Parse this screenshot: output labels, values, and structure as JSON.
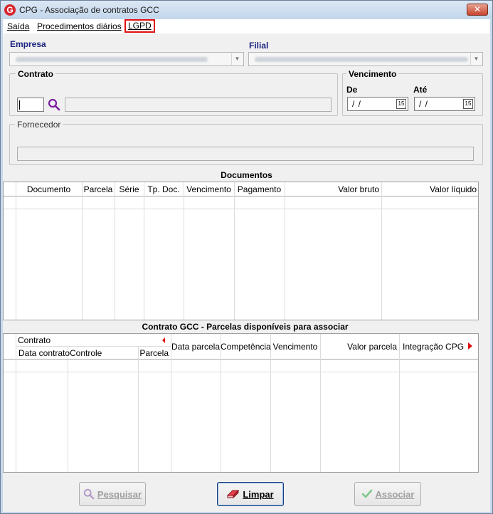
{
  "window": {
    "title": "CPG - Associação de contratos GCC",
    "close_label": "✕"
  },
  "menu": {
    "items": [
      {
        "label": "Saída"
      },
      {
        "label": "Procedimentos diários"
      },
      {
        "label": "LGPD"
      }
    ]
  },
  "filters": {
    "empresa_label": "Empresa",
    "filial_label": "Filial",
    "contrato_label": "Contrato",
    "vencimento_label": "Vencimento",
    "de_label": "De",
    "ate_label": "Até",
    "de_value": "/ /",
    "ate_value": "/ /",
    "calendar_label": "15",
    "fornecedor_label": "Fornecedor"
  },
  "documentos": {
    "title": "Documentos",
    "columns": [
      "Documento",
      "Parcela",
      "Série",
      "Tp. Doc.",
      "Vencimento",
      "Pagamento",
      "Valor bruto",
      "Valor líquido"
    ]
  },
  "parcelas": {
    "title": "Contrato GCC - Parcelas disponíveis para associar",
    "group_label": "Contrato",
    "sub_columns": [
      "Data contrato",
      "Controle",
      "Parcela"
    ],
    "columns": [
      "Data parcela",
      "Competência",
      "Vencimento",
      "Valor parcela",
      "Integração CPG"
    ]
  },
  "buttons": {
    "pesquisar": "Pesquisar",
    "limpar": "Limpar",
    "associar": "Associar"
  },
  "colors": {
    "accent": "#1a237e",
    "highlight": "#e01010",
    "search_icon": "#7b1fa2",
    "check": "#2e9e3e"
  }
}
